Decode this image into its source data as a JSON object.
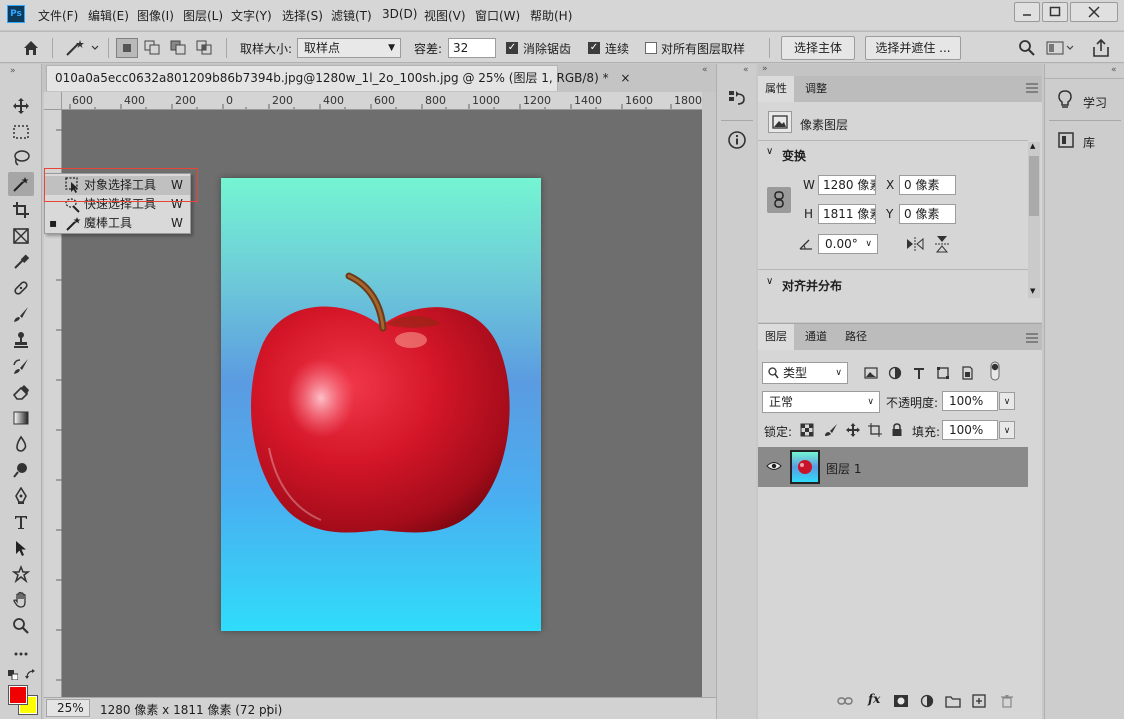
{
  "menubar": {
    "logo": "Ps",
    "items": [
      "文件(F)",
      "编辑(E)",
      "图像(I)",
      "图层(L)",
      "文字(Y)",
      "选择(S)",
      "滤镜(T)",
      "3D(D)",
      "视图(V)",
      "窗口(W)",
      "帮助(H)"
    ]
  },
  "options": {
    "sample_size_label": "取样大小:",
    "sample_size_value": "取样点",
    "tolerance_label": "容差:",
    "tolerance_value": "32",
    "antialias_label": "消除锯齿",
    "contiguous_label": "连续",
    "all_layers_label": "对所有图层取样",
    "select_subject_label": "选择主体",
    "select_mask_label": "选择并遮住 ..."
  },
  "document": {
    "tab_title": "010a0a5ecc0632a801209b86b7394b.jpg@1280w_1l_2o_100sh.jpg @ 25% (图层 1, RGB/8) *",
    "close_glyph": "×",
    "ruler_labels": [
      "600",
      "400",
      "200",
      "0",
      "200",
      "400",
      "600",
      "800",
      "1000",
      "1200",
      "1400",
      "1600",
      "1800"
    ],
    "zoom": "25%",
    "status": "1280 像素 x 1811 像素 (72 ppi)"
  },
  "flyout": {
    "items": [
      {
        "label": "对象选择工具",
        "shortcut": "W"
      },
      {
        "label": "快速选择工具",
        "shortcut": "W"
      },
      {
        "label": "魔棒工具",
        "shortcut": "W"
      }
    ]
  },
  "right_strip": {
    "learn_label": "学习",
    "library_label": "库"
  },
  "properties": {
    "tabs": [
      "属性",
      "调整"
    ],
    "layer_kind": "像素图层",
    "transform_title": "变换",
    "w_label": "W",
    "w_value": "1280 像素",
    "h_label": "H",
    "h_value": "1811 像素",
    "x_label": "X",
    "x_value": "0 像素",
    "y_label": "Y",
    "y_value": "0 像素",
    "angle_value": "0.00°",
    "align_title": "对齐并分布"
  },
  "layers_panel": {
    "tabs": [
      "图层",
      "通道",
      "路径"
    ],
    "filter_kind": "类型",
    "blend_mode": "正常",
    "opacity_label": "不透明度:",
    "opacity_value": "100%",
    "lock_label": "锁定:",
    "fill_label": "填充:",
    "fill_value": "100%",
    "layer_name": "图层 1",
    "fx_label": "fx"
  },
  "colors": {
    "foreground": "#f00000",
    "background": "#ffff00",
    "accent": "#31a8ff"
  }
}
